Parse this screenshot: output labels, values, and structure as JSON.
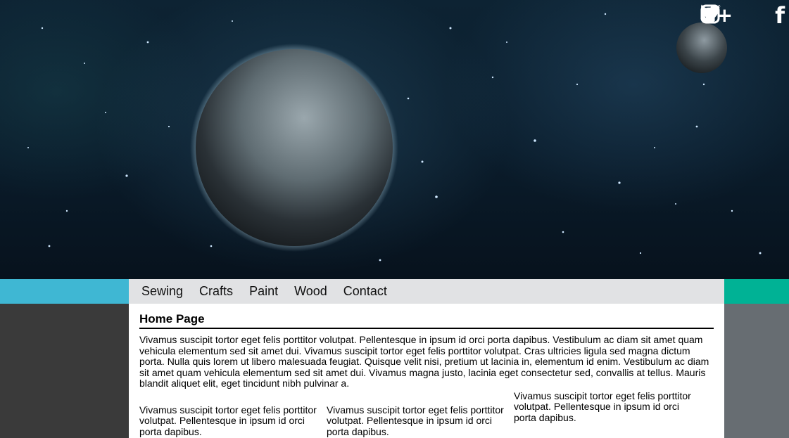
{
  "social": [
    {
      "icon": "google-plus-icon",
      "glyph": "G+"
    },
    {
      "icon": "instagram-icon",
      "glyph": ""
    },
    {
      "icon": "twitter-icon",
      "glyph": ""
    },
    {
      "icon": "facebook-icon",
      "glyph": "f"
    }
  ],
  "nav": {
    "items": [
      "Sewing",
      "Crafts",
      "Paint",
      "Wood",
      "Contact"
    ]
  },
  "page": {
    "title": "Home Page",
    "intro": "Vivamus suscipit tortor eget felis porttitor volutpat. Pellentesque in ipsum id orci porta dapibus. Vestibulum ac diam sit amet quam vehicula elementum sed sit amet dui. Vivamus suscipit tortor eget felis porttitor volutpat. Cras ultricies ligula sed magna dictum porta. Nulla quis lorem ut libero malesuada feugiat. Quisque velit nisi, pretium ut lacinia in, elementum id enim. Vestibulum ac diam sit amet quam vehicula elementum sed sit amet dui. Vivamus magna justo, lacinia eget consectetur sed, convallis at tellus. Mauris blandit aliquet elit, eget tincidunt nibh pulvinar a.",
    "columns": [
      "Vivamus suscipit tortor eget felis porttitor volutpat. Pellentesque in ipsum id orci porta dapibus.",
      "Vivamus suscipit tortor eget felis porttitor volutpat. Pellentesque in ipsum id orci porta dapibus.",
      "Vivamus suscipit tortor eget felis porttitor volutpat. Pellentesque in ipsum id orci porta dapibus."
    ]
  },
  "colors": {
    "accent_left": "#3fb7d3",
    "accent_right": "#00b295",
    "nav_bg": "#e1e2e4",
    "sidebar_left": "#3a3a3a",
    "sidebar_right": "#676d72"
  }
}
